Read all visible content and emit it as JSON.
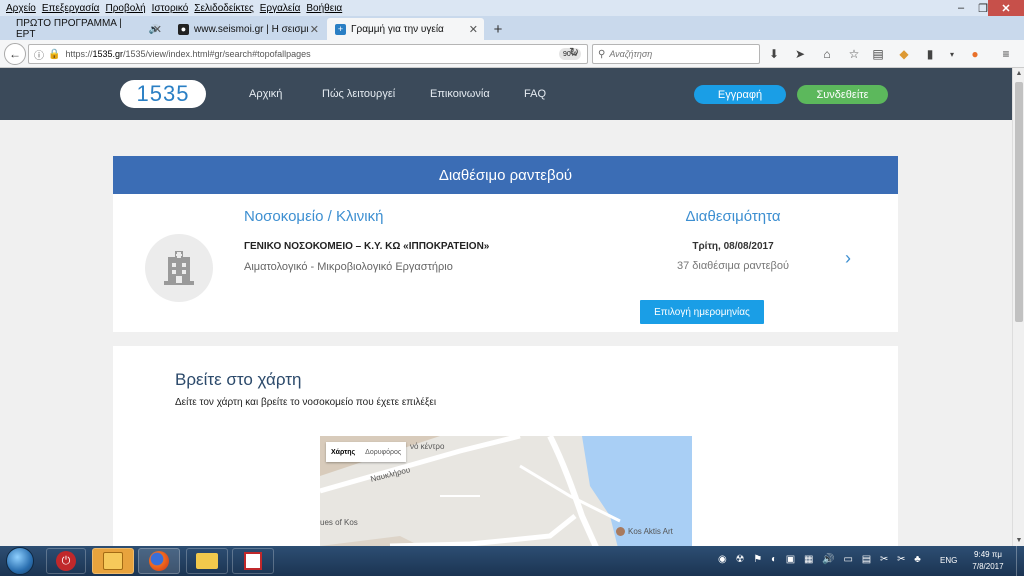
{
  "menubar": {
    "items": [
      "Αρχείο",
      "Επεξεργασία",
      "Προβολή",
      "Ιστορικό",
      "Σελιδοδείκτες",
      "Εργαλεία",
      "Βοήθεια"
    ]
  },
  "tabs": [
    {
      "label": "ΠΡΩΤΟ ΠΡΟΓΡΑΜΜΑ | ΕΡΤ",
      "active": false
    },
    {
      "label": "www.seismoi.gr | Η σεισμικ",
      "active": false
    },
    {
      "label": "Γραμμή για την υγεία",
      "active": true
    }
  ],
  "navbar": {
    "url_domain": "1535.gr",
    "url_prefix": "https://",
    "url_rest": "/1535/view/index.html#gr/search#topofallpages",
    "zoom": "90%",
    "search_placeholder": "Αναζήτηση"
  },
  "site": {
    "logo": "1535",
    "nav": [
      "Αρχική",
      "Πώς λειτουργεί",
      "Επικοινωνία",
      "FAQ"
    ],
    "register_label": "Εγγραφή",
    "login_label": "Συνδεθείτε"
  },
  "card": {
    "header": "Διαθέσιμο ραντεβού",
    "hospital_title": "Νοσοκομείο / Κλινική",
    "hospital_name": "ΓΕΝΙΚΟ ΝΟΣΟΚΟΜΕΙΟ – Κ.Υ. ΚΩ «ΙΠΠΟΚΡΑΤΕΙΟΝ»",
    "department": "Αιματολογικό - Μικροβιολογικό Εργαστήριο",
    "availability_title": "Διαθεσιμότητα",
    "date": "Τρίτη, 08/08/2017",
    "count": "37 διαθέσιμα ραντεβού",
    "choose_button": "Επιλογή ημερομηνίας"
  },
  "map": {
    "title": "Βρείτε στο χάρτη",
    "subtitle": "Δείτε τον χάρτη και βρείτε το νοσοκομείο που έχετε επιλέξει",
    "toggle_map": "Χάρτης",
    "toggle_satellite": "Δορυφόρος",
    "labels": [
      "νό κέντρο",
      "Ναυκλήρου",
      "ues of Kos",
      "Kos Aktis Art"
    ]
  },
  "taskbar": {
    "lang": "ENG",
    "time": "9:49 πμ",
    "date": "7/8/2017"
  }
}
